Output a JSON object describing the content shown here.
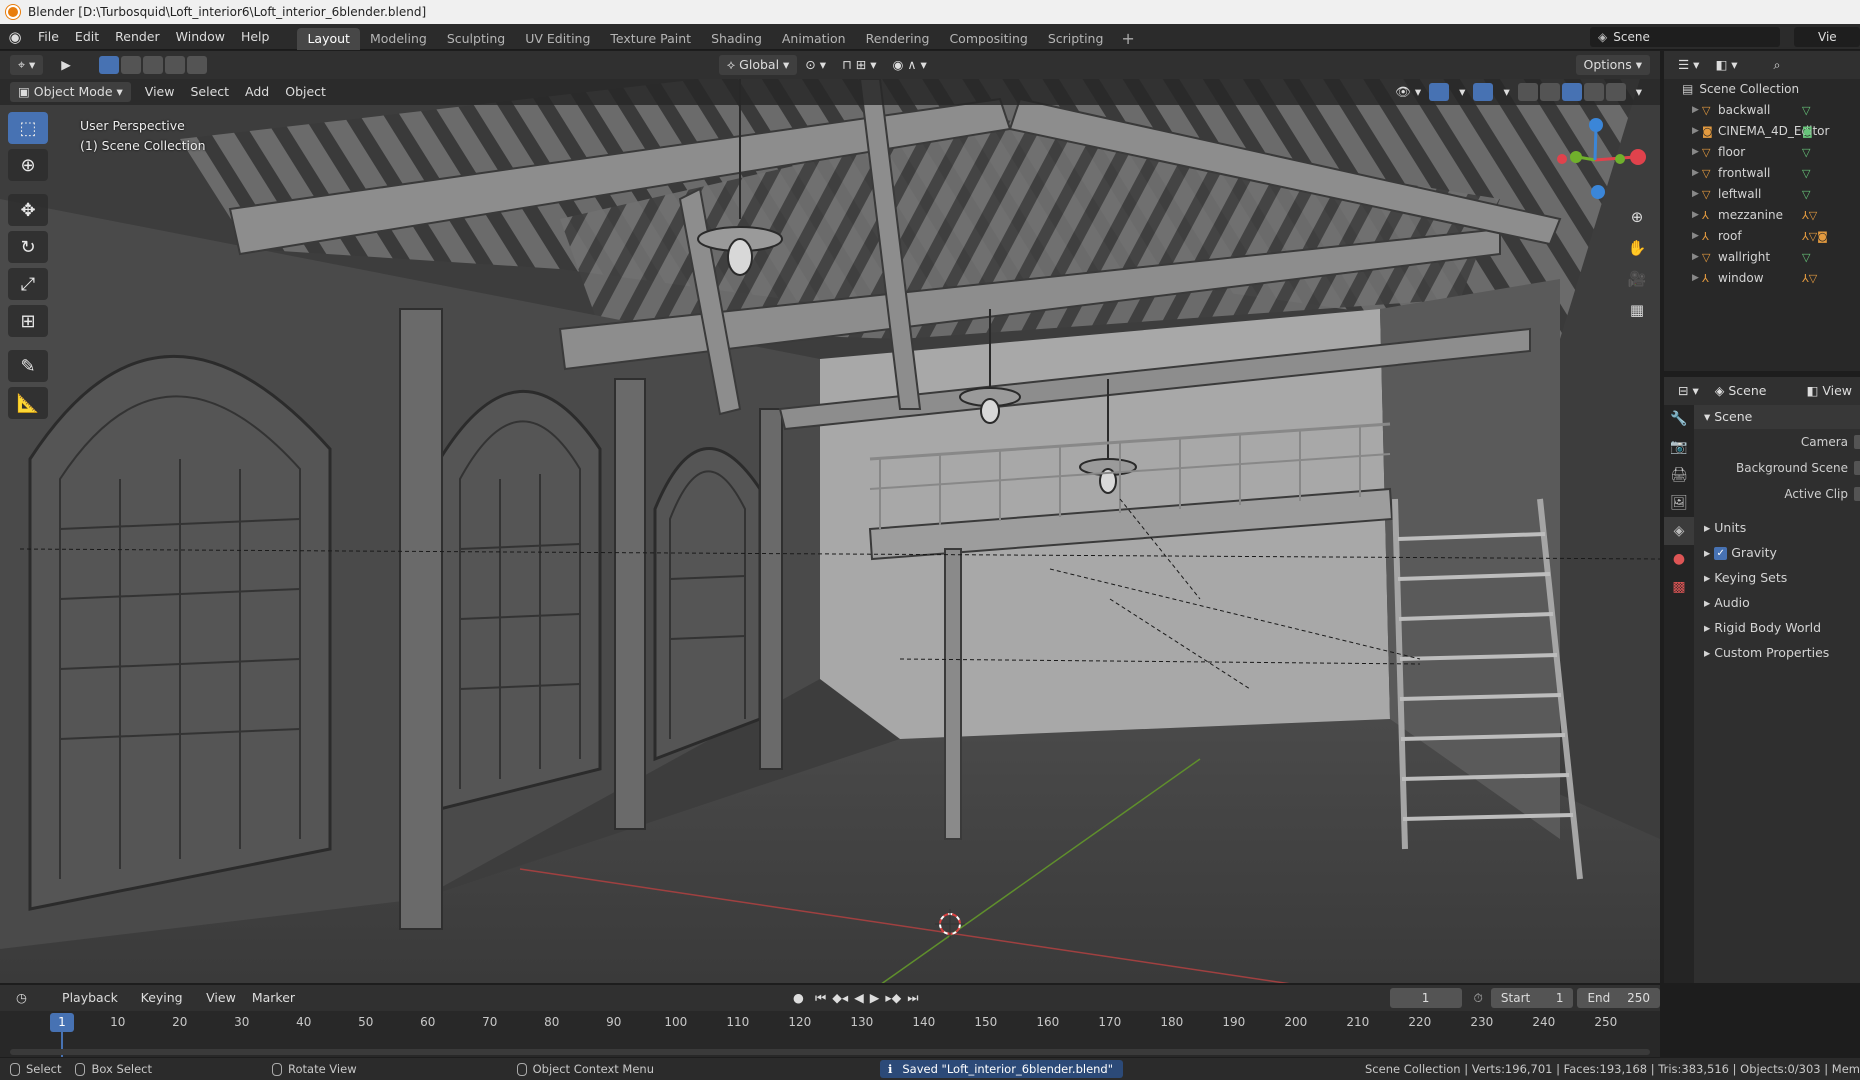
{
  "window": {
    "title": "Blender [D:\\Turbosquid\\Loft_interior6\\Loft_interior_6blender.blend]"
  },
  "menubar": {
    "items": [
      "File",
      "Edit",
      "Render",
      "Window",
      "Help"
    ],
    "workspaces": [
      "Layout",
      "Modeling",
      "Sculpting",
      "UV Editing",
      "Texture Paint",
      "Shading",
      "Animation",
      "Rendering",
      "Compositing",
      "Scripting"
    ],
    "active_workspace": "Layout",
    "scene": "Scene",
    "view_layer": "Vie"
  },
  "viewport": {
    "transform_orientation": "Global",
    "options_label": "Options",
    "mode": "Object Mode",
    "menus": [
      "View",
      "Select",
      "Add",
      "Object"
    ],
    "perspective_label": "User Perspective",
    "collection_label": "(1) Scene Collection",
    "tools": [
      "select-box",
      "cursor",
      "move",
      "rotate",
      "scale",
      "transform",
      "annotate",
      "measure"
    ],
    "active_tool": "select-box"
  },
  "outliner": {
    "root": "Scene Collection",
    "items": [
      {
        "name": "backwall",
        "type": "mesh"
      },
      {
        "name": "CINEMA_4D_Editor",
        "type": "camera"
      },
      {
        "name": "floor",
        "type": "mesh"
      },
      {
        "name": "frontwall",
        "type": "mesh"
      },
      {
        "name": "leftwall",
        "type": "mesh"
      },
      {
        "name": "mezzanine",
        "type": "empty"
      },
      {
        "name": "roof",
        "type": "empty"
      },
      {
        "name": "wallright",
        "type": "mesh"
      },
      {
        "name": "window",
        "type": "empty"
      }
    ]
  },
  "properties": {
    "header_scene": "Scene",
    "header_view": "View",
    "panel_title": "Scene",
    "fields": [
      "Camera",
      "Background Scene",
      "Active Clip"
    ],
    "subpanels": [
      {
        "label": "Units",
        "checkbox": false
      },
      {
        "label": "Gravity",
        "checkbox": true
      },
      {
        "label": "Keying Sets",
        "checkbox": false
      },
      {
        "label": "Audio",
        "checkbox": false
      },
      {
        "label": "Rigid Body World",
        "checkbox": false
      },
      {
        "label": "Custom Properties",
        "checkbox": false
      }
    ]
  },
  "timeline": {
    "menus": [
      "Playback",
      "Keying",
      "View",
      "Marker"
    ],
    "current_frame": "1",
    "start_label": "Start",
    "start": "1",
    "end_label": "End",
    "end": "250",
    "ticks": [
      1,
      10,
      20,
      30,
      40,
      50,
      60,
      70,
      80,
      90,
      100,
      110,
      120,
      130,
      140,
      150,
      160,
      170,
      180,
      190,
      200,
      210,
      220,
      230,
      240,
      250
    ]
  },
  "statusbar": {
    "select": "Select",
    "box_select": "Box Select",
    "rotate_view": "Rotate View",
    "context_menu": "Object Context Menu",
    "message": "Saved \"Loft_interior_6blender.blend\"",
    "stats": "Scene Collection | Verts:196,701 | Faces:193,168 | Tris:383,516 | Objects:0/303 | Mem"
  },
  "colors": {
    "accent": "#4772b3",
    "object_orange": "#e39a3f",
    "mesh_green": "#67c57a",
    "axis_x": "#e0424c",
    "axis_y": "#70b02c",
    "axis_z": "#3b86d8"
  }
}
